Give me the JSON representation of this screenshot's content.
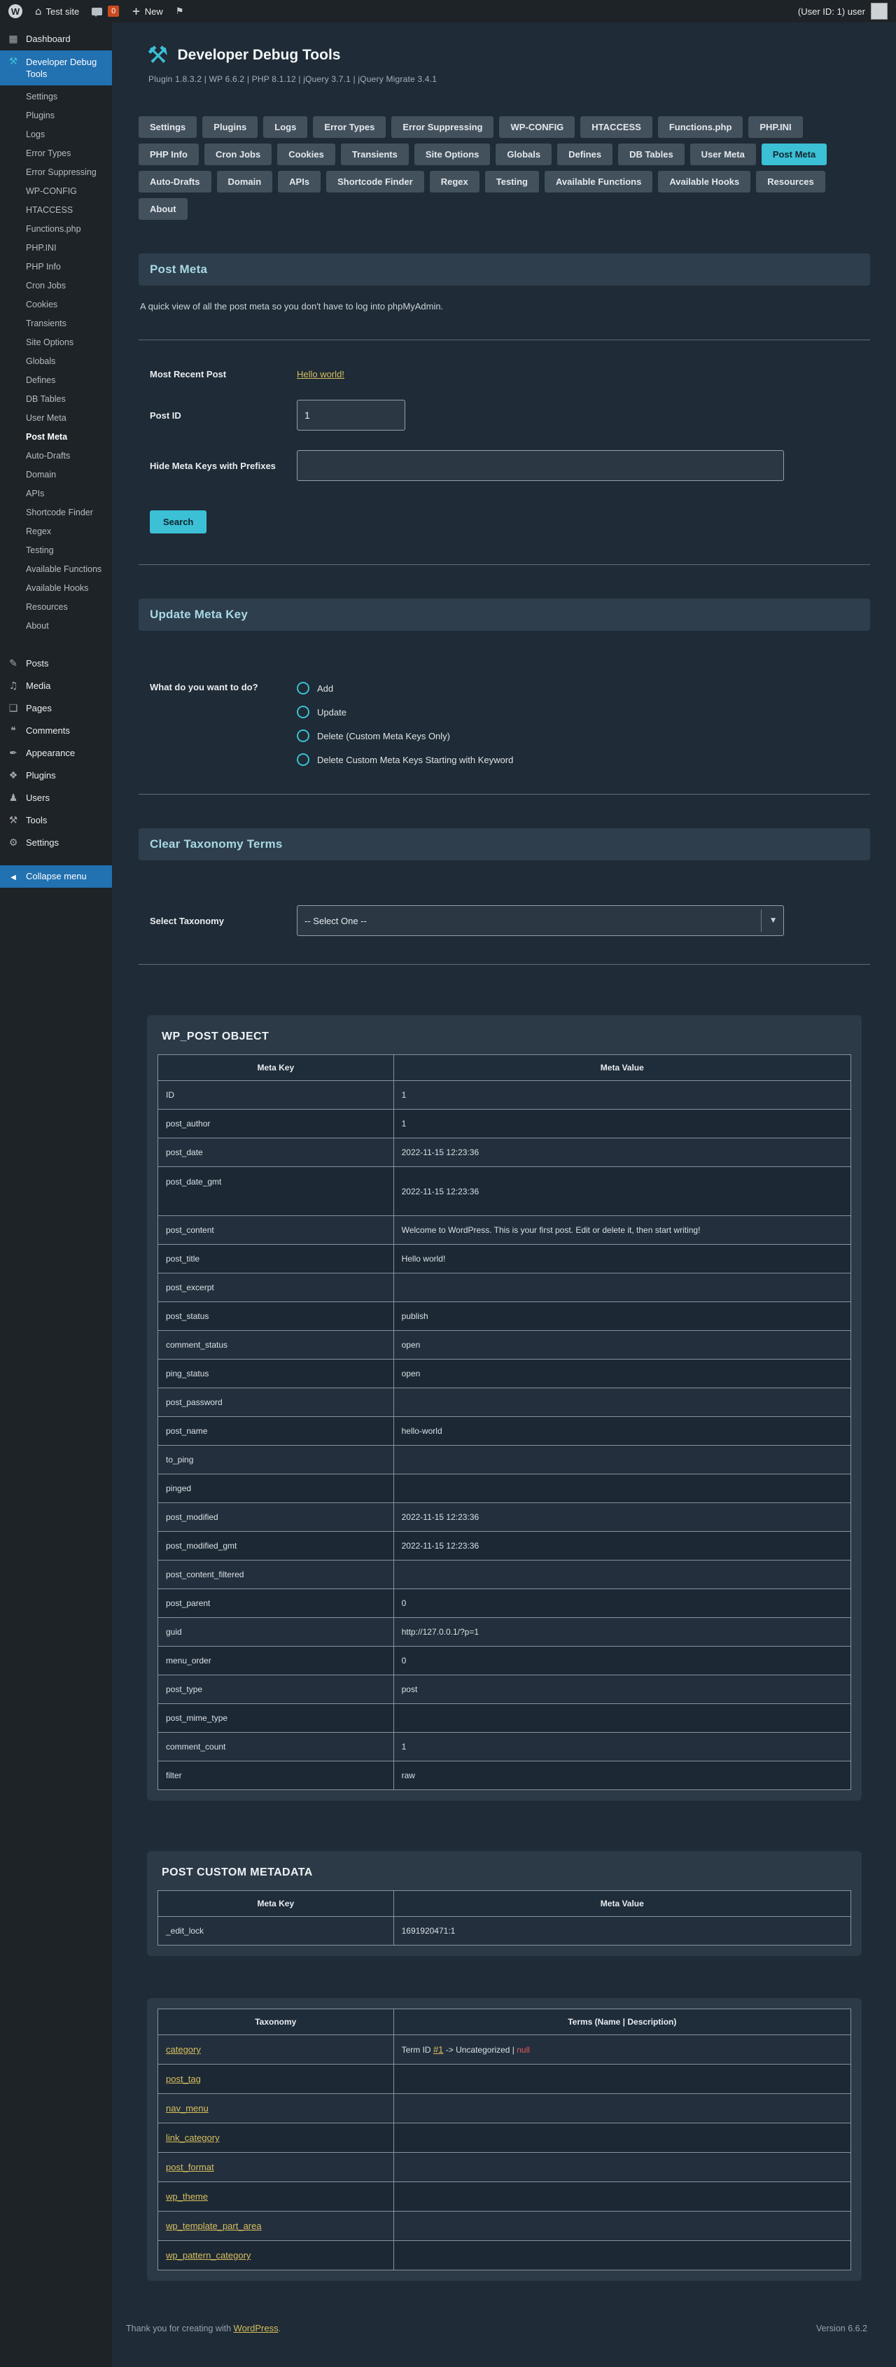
{
  "colors": {
    "accent": "#3bc0d6",
    "link_yellow": "#d8bf5e",
    "wp_blue": "#2271b1",
    "error_red": "#e05b5b",
    "admin_bar_bg": "#1d2327",
    "main_bg": "#1f2b36",
    "panel_bg": "#2c3a47",
    "section_bg": "#2e3e4d"
  },
  "admin_bar": {
    "site_name": "Test site",
    "comments_badge": "0",
    "new_label": "New",
    "user_label": "(User ID: 1) user"
  },
  "sidebar": {
    "dashboard": "Dashboard",
    "plugin_title": "Developer Debug Tools",
    "plugin_submenu": [
      {
        "label": "Settings"
      },
      {
        "label": "Plugins"
      },
      {
        "label": "Logs"
      },
      {
        "label": "Error Types"
      },
      {
        "label": "Error Suppressing"
      },
      {
        "label": "WP-CONFIG"
      },
      {
        "label": "HTACCESS"
      },
      {
        "label": "Functions.php"
      },
      {
        "label": "PHP.INI"
      },
      {
        "label": "PHP Info"
      },
      {
        "label": "Cron Jobs"
      },
      {
        "label": "Cookies"
      },
      {
        "label": "Transients"
      },
      {
        "label": "Site Options"
      },
      {
        "label": "Globals"
      },
      {
        "label": "Defines"
      },
      {
        "label": "DB Tables"
      },
      {
        "label": "User Meta"
      },
      {
        "label": "Post Meta",
        "active": true
      },
      {
        "label": "Auto-Drafts"
      },
      {
        "label": "Domain"
      },
      {
        "label": "APIs"
      },
      {
        "label": "Shortcode Finder"
      },
      {
        "label": "Regex"
      },
      {
        "label": "Testing"
      },
      {
        "label": "Available Functions"
      },
      {
        "label": "Available Hooks"
      },
      {
        "label": "Resources"
      },
      {
        "label": "About"
      }
    ],
    "menu_items": [
      {
        "label": "Posts",
        "icon": "posts-icon"
      },
      {
        "label": "Media",
        "icon": "media-icon"
      },
      {
        "label": "Pages",
        "icon": "pages-icon"
      },
      {
        "label": "Comments",
        "icon": "comments-icon"
      },
      {
        "label": "Appearance",
        "icon": "appearance-icon"
      },
      {
        "label": "Plugins",
        "icon": "plugins-icon"
      },
      {
        "label": "Users",
        "icon": "users-icon"
      },
      {
        "label": "Tools",
        "icon": "tools-icon"
      },
      {
        "label": "Settings",
        "icon": "settings-icon"
      }
    ],
    "collapse": "Collapse menu"
  },
  "header": {
    "title": "Developer Debug Tools",
    "version_line": "Plugin 1.8.3.2  |  WP 6.6.2  |  PHP 8.1.12  |  jQuery 3.7.1  |  jQuery Migrate 3.4.1"
  },
  "tabs": [
    {
      "label": "Settings"
    },
    {
      "label": "Plugins"
    },
    {
      "label": "Logs"
    },
    {
      "label": "Error Types"
    },
    {
      "label": "Error Suppressing"
    },
    {
      "label": "WP-CONFIG"
    },
    {
      "label": "HTACCESS"
    },
    {
      "label": "Functions.php"
    },
    {
      "label": "PHP.INI"
    },
    {
      "label": "PHP Info"
    },
    {
      "label": "Cron Jobs"
    },
    {
      "label": "Cookies"
    },
    {
      "label": "Transients"
    },
    {
      "label": "Site Options"
    },
    {
      "label": "Globals"
    },
    {
      "label": "Defines"
    },
    {
      "label": "DB Tables"
    },
    {
      "label": "User Meta"
    },
    {
      "label": "Post Meta",
      "active": true
    },
    {
      "label": "Auto-Drafts"
    },
    {
      "label": "Domain"
    },
    {
      "label": "APIs"
    },
    {
      "label": "Shortcode Finder"
    },
    {
      "label": "Regex"
    },
    {
      "label": "Testing"
    },
    {
      "label": "Available Functions"
    },
    {
      "label": "Available Hooks"
    },
    {
      "label": "Resources"
    },
    {
      "label": "About"
    }
  ],
  "post_meta_section": {
    "title": "Post Meta",
    "description": "A quick view of all the post meta so you don't have to log into phpMyAdmin.",
    "most_recent_label": "Most Recent Post",
    "most_recent_link": "Hello world!",
    "post_id_label": "Post ID",
    "post_id_value": "1",
    "hide_prefixes_label": "Hide Meta Keys with Prefixes",
    "search_button": "Search"
  },
  "update_meta_section": {
    "title": "Update Meta Key",
    "question": "What do you want to do?",
    "options": [
      "Add",
      "Update",
      "Delete (Custom Meta Keys Only)",
      "Delete Custom Meta Keys Starting with Keyword"
    ]
  },
  "taxonomy_section": {
    "title": "Clear Taxonomy Terms",
    "label": "Select Taxonomy",
    "select_value": "-- Select One --"
  },
  "wp_post_object": {
    "title": "WP_POST OBJECT",
    "columns": [
      "Meta Key",
      "Meta Value"
    ],
    "rows": [
      {
        "key": "ID",
        "value": "1"
      },
      {
        "key": "post_author",
        "value": "1"
      },
      {
        "key": "post_date",
        "value": "2022-11-15 12:23:36"
      },
      {
        "key": "post_date_gmt",
        "value": "2022-11-15 12:23:36"
      },
      {
        "key": "post_content",
        "value": "Welcome to WordPress. This is your first post. Edit or delete it, then start writing!"
      },
      {
        "key": "post_title",
        "value": "Hello world!"
      },
      {
        "key": "post_excerpt",
        "value": ""
      },
      {
        "key": "post_status",
        "value": "publish"
      },
      {
        "key": "comment_status",
        "value": "open"
      },
      {
        "key": "ping_status",
        "value": "open"
      },
      {
        "key": "post_password",
        "value": ""
      },
      {
        "key": "post_name",
        "value": "hello-world"
      },
      {
        "key": "to_ping",
        "value": ""
      },
      {
        "key": "pinged",
        "value": ""
      },
      {
        "key": "post_modified",
        "value": "2022-11-15 12:23:36"
      },
      {
        "key": "post_modified_gmt",
        "value": "2022-11-15 12:23:36"
      },
      {
        "key": "post_content_filtered",
        "value": ""
      },
      {
        "key": "post_parent",
        "value": "0"
      },
      {
        "key": "guid",
        "value": "http://127.0.0.1/?p=1"
      },
      {
        "key": "menu_order",
        "value": "0"
      },
      {
        "key": "post_type",
        "value": "post"
      },
      {
        "key": "post_mime_type",
        "value": ""
      },
      {
        "key": "comment_count",
        "value": "1"
      },
      {
        "key": "filter",
        "value": "raw"
      }
    ]
  },
  "post_custom_metadata": {
    "title": "POST CUSTOM METADATA",
    "columns": [
      "Meta Key",
      "Meta Value"
    ],
    "rows": [
      {
        "key": "_edit_lock",
        "value": "1691920471:1"
      }
    ]
  },
  "taxonomy_table": {
    "columns": [
      "Taxonomy",
      "Terms (Name | Description)"
    ],
    "rows": [
      {
        "taxonomy": "category",
        "term_prefix": "Term ID ",
        "term_link": "#1",
        "term_rest": " -> Uncategorized | ",
        "term_null": "null"
      },
      {
        "taxonomy": "post_tag",
        "term_prefix": "",
        "term_link": "",
        "term_rest": "",
        "term_null": ""
      },
      {
        "taxonomy": "nav_menu",
        "term_prefix": "",
        "term_link": "",
        "term_rest": "",
        "term_null": ""
      },
      {
        "taxonomy": "link_category",
        "term_prefix": "",
        "term_link": "",
        "term_rest": "",
        "term_null": ""
      },
      {
        "taxonomy": "post_format",
        "term_prefix": "",
        "term_link": "",
        "term_rest": "",
        "term_null": ""
      },
      {
        "taxonomy": "wp_theme",
        "term_prefix": "",
        "term_link": "",
        "term_rest": "",
        "term_null": ""
      },
      {
        "taxonomy": "wp_template_part_area",
        "term_prefix": "",
        "term_link": "",
        "term_rest": "",
        "term_null": ""
      },
      {
        "taxonomy": "wp_pattern_category",
        "term_prefix": "",
        "term_link": "",
        "term_rest": "",
        "term_null": ""
      }
    ]
  },
  "footer": {
    "thanks_prefix": "Thank you for creating with ",
    "wordpress_link": "WordPress",
    "thanks_suffix": ".",
    "version": "Version 6.6.2"
  }
}
